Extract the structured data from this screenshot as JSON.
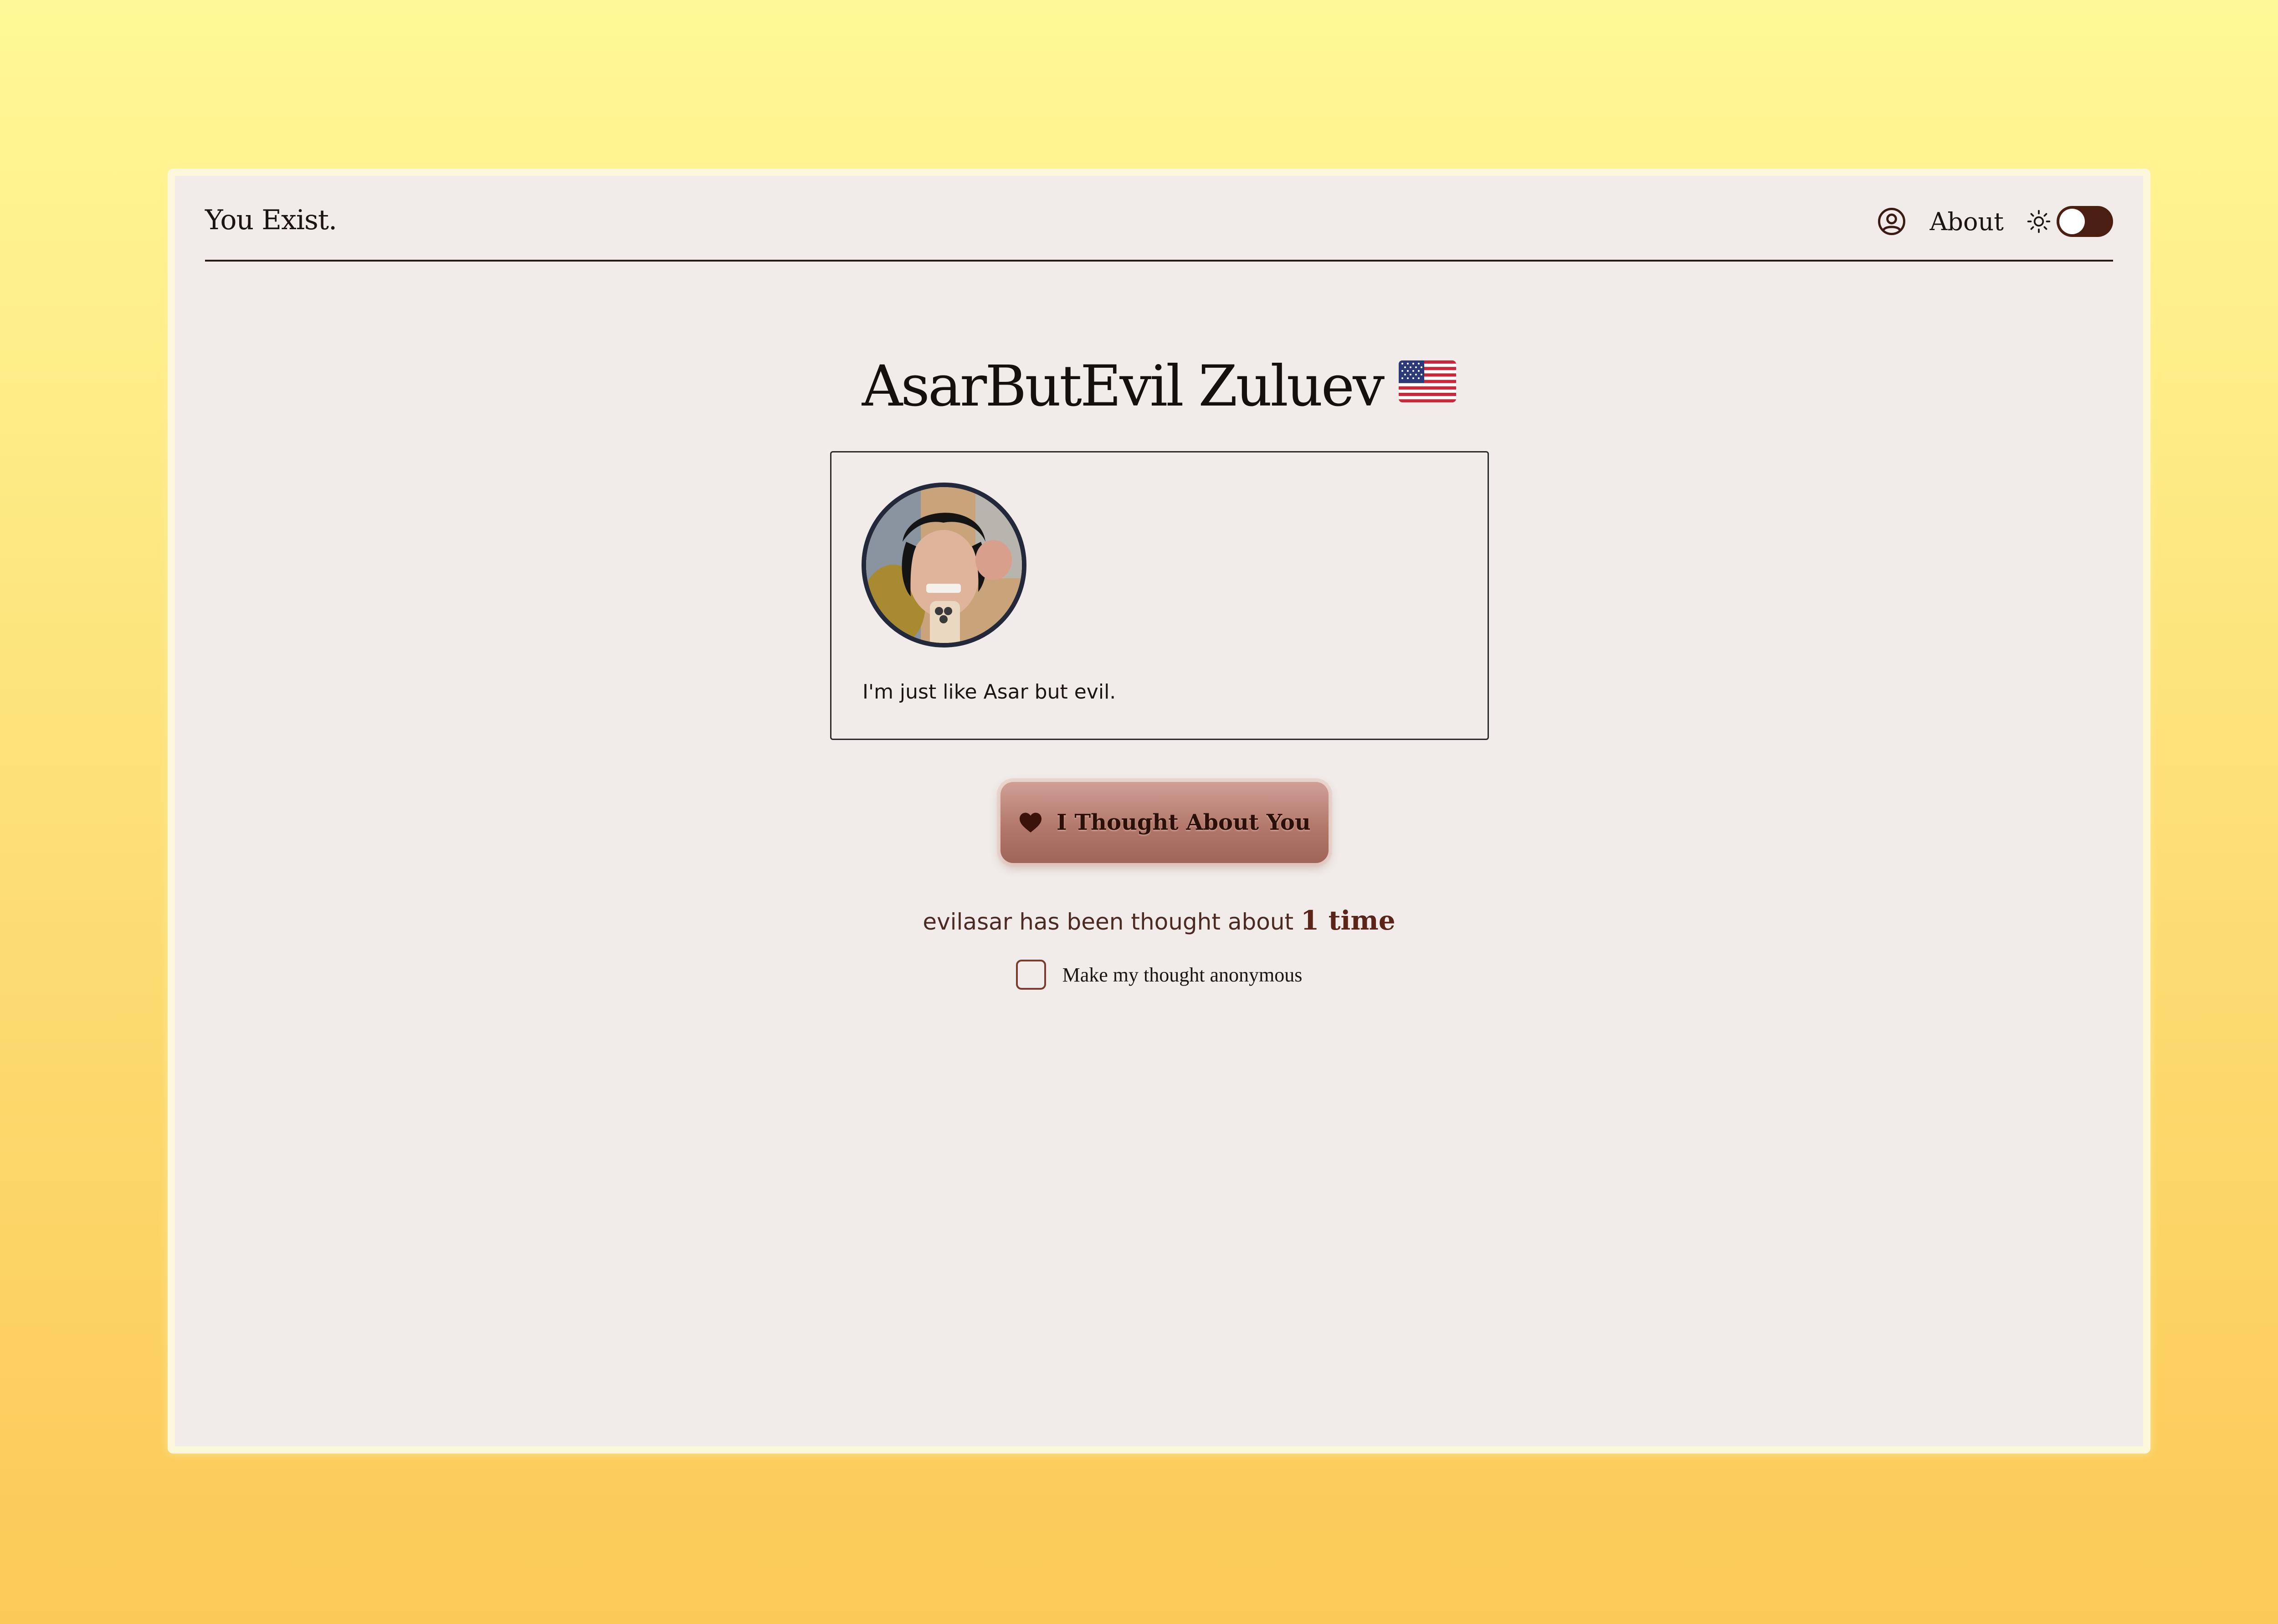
{
  "header": {
    "brand": "You Exist.",
    "about_label": "About",
    "icons": [
      "profile-icon",
      "sun-icon"
    ],
    "theme_toggle_on": false
  },
  "profile": {
    "name": "AsarButEvil Zuluev",
    "flag": "us-flag",
    "bio": "I'm just like Asar but evil.",
    "username": "evilasar"
  },
  "think": {
    "button_label": "I Thought About You",
    "count_prefix": "evilasar has been thought about",
    "count_value": "1 time",
    "anonymous_label": "Make my thought anonymous",
    "anonymous_checked": false
  },
  "colors": {
    "background_top": "#fef996",
    "background_bottom": "#fbc957",
    "panel": "#f1ece9",
    "accent": "#4a1f12",
    "button": "#b3786b"
  }
}
